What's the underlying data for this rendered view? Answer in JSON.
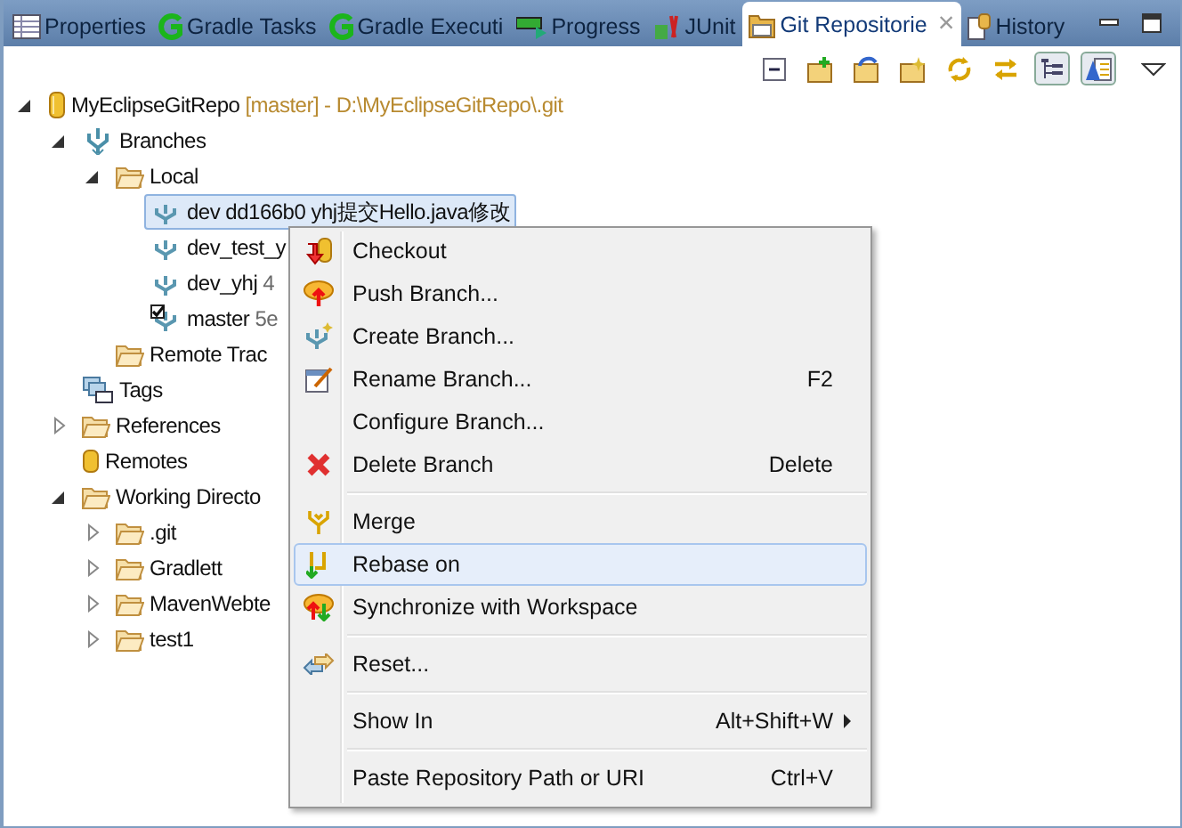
{
  "tabs": [
    {
      "label": "Properties",
      "selected": false,
      "closable": false
    },
    {
      "label": "Gradle Tasks",
      "selected": false,
      "closable": false
    },
    {
      "label": "Gradle Executi",
      "selected": false,
      "closable": false
    },
    {
      "label": "Progress",
      "selected": false,
      "closable": false
    },
    {
      "label": "JUnit",
      "selected": false,
      "closable": false
    },
    {
      "label": "Git Repositorie",
      "selected": true,
      "closable": true
    },
    {
      "label": "History",
      "selected": false,
      "closable": false
    }
  ],
  "close_glyph": "×",
  "tree": [
    {
      "kind": "repository",
      "label": "MyEclipseGitRepo",
      "branch": "[master]",
      "path": "- D:\\MyEclipseGitRepo\\.git",
      "expanded": true,
      "selected": false,
      "children": [
        {
          "kind": "branches",
          "label": "Branches",
          "expanded": true,
          "selected": false,
          "children": [
            {
              "kind": "folder",
              "label": "Local",
              "expanded": true,
              "selected": false,
              "children": [
                {
                  "kind": "branch",
                  "label": "dev dd166b0 yhj提交Hello.java修改",
                  "checked_out": false,
                  "selected": true
                },
                {
                  "kind": "branch",
                  "label": "dev_test_y",
                  "checked_out": false,
                  "selected": false
                },
                {
                  "kind": "branch",
                  "label": "dev_yhj",
                  "detail": "4",
                  "checked_out": false,
                  "selected": false
                },
                {
                  "kind": "branch",
                  "label": "master",
                  "detail": "5e",
                  "checked_out": true,
                  "selected": false
                }
              ]
            },
            {
              "kind": "folder",
              "label": "Remote Trac",
              "selected": false
            }
          ]
        },
        {
          "kind": "tags",
          "label": "Tags",
          "selected": false
        },
        {
          "kind": "folder",
          "label": "References",
          "expanded": false,
          "selected": false
        },
        {
          "kind": "remotes",
          "label": "Remotes",
          "selected": false
        },
        {
          "kind": "folder",
          "label": "Working Directo",
          "expanded": true,
          "selected": false,
          "children": [
            {
              "kind": "folder",
              "label": ".git",
              "expanded": false,
              "selected": false
            },
            {
              "kind": "folder",
              "label": "Gradlett",
              "expanded": false,
              "selected": false
            },
            {
              "kind": "folder",
              "label": "MavenWebte",
              "expanded": false,
              "selected": false
            },
            {
              "kind": "folder",
              "label": "test1",
              "expanded": false,
              "selected": false
            }
          ]
        }
      ]
    }
  ],
  "context_menu": [
    {
      "kind": "item",
      "label": "Checkout",
      "selected": false
    },
    {
      "kind": "item",
      "label": "Push Branch...",
      "selected": false
    },
    {
      "kind": "item",
      "label": "Create Branch...",
      "selected": false
    },
    {
      "kind": "item",
      "label": "Rename Branch...",
      "shortcut": "F2",
      "selected": false
    },
    {
      "kind": "item",
      "label": "Configure Branch...",
      "selected": false
    },
    {
      "kind": "item",
      "label": "Delete Branch",
      "shortcut": "Delete",
      "selected": false
    },
    {
      "kind": "separator"
    },
    {
      "kind": "item",
      "label": "Merge",
      "selected": false
    },
    {
      "kind": "item",
      "label": "Rebase on",
      "selected": true
    },
    {
      "kind": "item",
      "label": "Synchronize with Workspace",
      "selected": false
    },
    {
      "kind": "separator"
    },
    {
      "kind": "item",
      "label": "Reset...",
      "selected": false
    },
    {
      "kind": "separator"
    },
    {
      "kind": "item",
      "label": "Show In",
      "shortcut": "Alt+Shift+W",
      "submenu": true,
      "selected": false
    },
    {
      "kind": "separator"
    },
    {
      "kind": "item",
      "label": "Paste Repository Path or URI",
      "shortcut": "Ctrl+V",
      "selected": false
    }
  ]
}
